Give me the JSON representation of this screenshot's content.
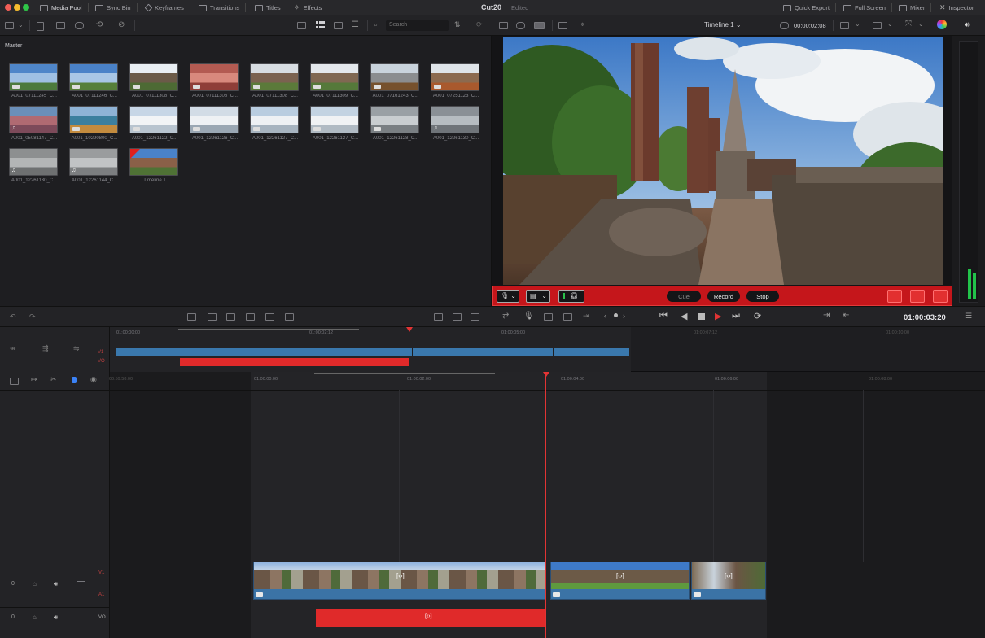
{
  "app": {
    "title": "Cut20",
    "status": "Edited"
  },
  "menubar": {
    "tabs": [
      {
        "label": "Media Pool",
        "icon": "media-pool-icon"
      },
      {
        "label": "Sync Bin",
        "icon": "sync-bin-icon"
      },
      {
        "label": "Keyframes",
        "icon": "keyframes-icon"
      },
      {
        "label": "Transitions",
        "icon": "transitions-icon"
      },
      {
        "label": "Titles",
        "icon": "titles-icon"
      },
      {
        "label": "Effects",
        "icon": "effects-icon"
      }
    ],
    "right_tabs": [
      {
        "label": "Quick Export",
        "icon": "quick-export-icon"
      },
      {
        "label": "Full Screen",
        "icon": "full-screen-icon"
      },
      {
        "label": "Mixer",
        "icon": "mixer-icon"
      },
      {
        "label": "Inspector",
        "icon": "inspector-icon"
      }
    ]
  },
  "toolbar": {
    "search_placeholder": "Search",
    "timeline_name": "Timeline 1",
    "source_timecode": "00:00:02:08"
  },
  "media_pool": {
    "bin": "Master",
    "clips": [
      {
        "name": "A001_07111245_C...",
        "colors": [
          "#4f86c9",
          "#9fc0e4",
          "#4c7a3d"
        ],
        "badge": true
      },
      {
        "name": "A001_07111246_C...",
        "colors": [
          "#4a82c8",
          "#a8c6e6",
          "#567f3a"
        ],
        "badge": true
      },
      {
        "name": "A001_07111308_C...",
        "colors": [
          "#e9eef3",
          "#6b5a48",
          "#4d6a34"
        ],
        "badge": true
      },
      {
        "name": "A001_07111308_C...",
        "colors": [
          "#b35b52",
          "#d8897d",
          "#8f3e38"
        ],
        "badge": true
      },
      {
        "name": "A001_07111308_C...",
        "colors": [
          "#d8dde2",
          "#7b6250",
          "#5b7a3a"
        ],
        "badge": true
      },
      {
        "name": "A001_07111309_C...",
        "colors": [
          "#e4e8ec",
          "#806852",
          "#55793a"
        ],
        "badge": true
      },
      {
        "name": "A001_07161243_C...",
        "colors": [
          "#c9d3dc",
          "#8b8d8f",
          "#76512d"
        ],
        "badge": true
      },
      {
        "name": "A001_07251123_C...",
        "colors": [
          "#dfe4e9",
          "#8c6a4f",
          "#a9592d"
        ],
        "badge": true
      },
      {
        "name": "A001_05081147_C...",
        "colors": [
          "#6a8fb9",
          "#b06a72",
          "#7d4a5a"
        ],
        "note": true
      },
      {
        "name": "A001_10290800_C...",
        "colors": [
          "#8fb3d6",
          "#3c7f9e",
          "#c38b3e"
        ],
        "badge": true
      },
      {
        "name": "A001_12261122_C...",
        "colors": [
          "#c7d6e6",
          "#f2f4f6",
          "#b8c4cf"
        ],
        "badge": true
      },
      {
        "name": "A001_12261126_C...",
        "colors": [
          "#d2dce6",
          "#eef1f4",
          "#9aa7b3"
        ],
        "badge": true
      },
      {
        "name": "A001_12261127_C...",
        "colors": [
          "#b9cde0",
          "#eef1f4",
          "#a7b4c0"
        ],
        "badge": true
      },
      {
        "name": "A001_12261127_C...",
        "colors": [
          "#c3d3e2",
          "#f0f2f4",
          "#b0bac3"
        ],
        "badge": true
      },
      {
        "name": "A001_12261128_C...",
        "colors": [
          "#9aa0a5",
          "#c9cdd0",
          "#7a7f83"
        ],
        "badge": true
      },
      {
        "name": "A001_12261130_C...",
        "colors": [
          "#8a9096",
          "#b6bcc1",
          "#6f7479"
        ],
        "note": true
      },
      {
        "name": "A001_12261130_C...",
        "colors": [
          "#8d8f90",
          "#b3b5b6",
          "#6e7071"
        ],
        "note": true
      },
      {
        "name": "A001_12261144_C...",
        "colors": [
          "#9a9c9e",
          "#c1c3c5",
          "#7c7e80"
        ],
        "note": true
      },
      {
        "name": "Timeline 1",
        "colors": [
          "#4a82c8",
          "#8a6048",
          "#4f7235"
        ],
        "flag": true
      }
    ]
  },
  "recorder": {
    "cue": "Cue",
    "record": "Record",
    "stop": "Stop"
  },
  "transport": {
    "timecode": "01:00:03:20"
  },
  "upper_timeline": {
    "ruler": [
      "01:00:00:00",
      "01:00:02:12",
      "01:00:05:00",
      "01:00:07:12",
      "01:00:10:00"
    ],
    "tracks": [
      "V1",
      "VO"
    ]
  },
  "lower_timeline": {
    "ruler": [
      "01:00:00:00",
      "01:00:02:00",
      "01:00:04:00",
      "01:00:06:00",
      "01:00:08:00"
    ],
    "ruler_left": "00:59:58:00",
    "tracks": [
      {
        "name": "V1",
        "sub": "A1",
        "num": "0"
      },
      {
        "name": "VO",
        "num": "0"
      }
    ],
    "clip_marker": "[‹›]",
    "vo_marker": "[‹›]"
  },
  "colors": {
    "accent": "#e23434",
    "record": "#c5161b",
    "clip_blue": "#3b73a6",
    "green_meter": "#22c34a"
  }
}
